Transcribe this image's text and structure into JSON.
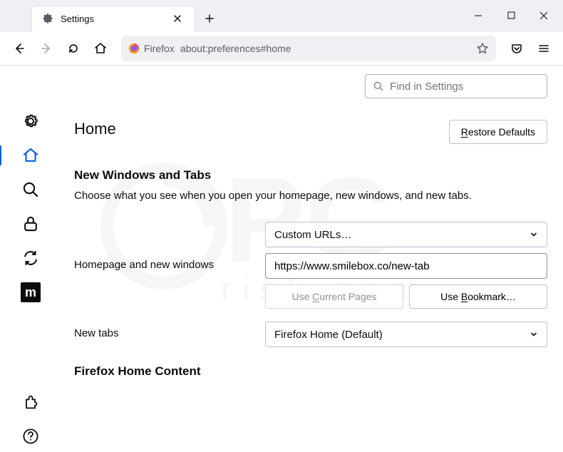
{
  "tab": {
    "label": "Settings"
  },
  "urlbar": {
    "identity": "Firefox",
    "url": "about:preferences#home"
  },
  "search": {
    "placeholder": "Find in Settings"
  },
  "heading": "Home",
  "restore_btn": "Restore Defaults",
  "section": {
    "title": "New Windows and Tabs",
    "desc": "Choose what you see when you open your homepage, new windows, and new tabs."
  },
  "homepage": {
    "label": "Homepage and new windows",
    "select": "Custom URLs…",
    "url": "https://www.smilebox.co/new-tab",
    "use_current": "Use Current Pages",
    "use_bookmark": "Use Bookmark…"
  },
  "newtabs": {
    "label": "New tabs",
    "select": "Firefox Home (Default)"
  },
  "fhc": "Firefox Home Content"
}
